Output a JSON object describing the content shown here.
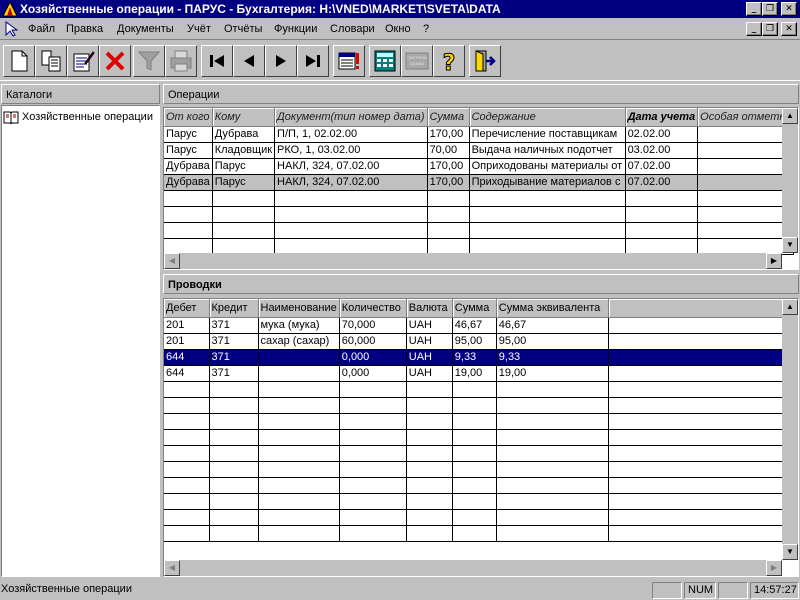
{
  "window": {
    "title": "Хозяйственные операции - ПАРУС - Бухгалтерия: H:\\VNED\\MARKET\\SVETA\\DATA",
    "btn_min": "_",
    "btn_restore": "❐",
    "btn_close": "✕"
  },
  "menu": [
    "Файл",
    "Правка",
    "Документы",
    "Учёт",
    "Отчёты",
    "Функции",
    "Словари",
    "Окно",
    "?"
  ],
  "toolbar": [
    {
      "name": "new-document-icon",
      "interactable": true
    },
    {
      "name": "copy-document-icon",
      "interactable": true
    },
    {
      "name": "edit-document-icon",
      "interactable": true
    },
    {
      "name": "delete-icon",
      "interactable": true
    },
    {
      "name": "filter-icon",
      "interactable": false
    },
    {
      "name": "print-icon",
      "interactable": false
    },
    {
      "name": "first-record-icon",
      "interactable": true
    },
    {
      "name": "previous-record-icon",
      "interactable": true
    },
    {
      "name": "next-record-icon",
      "interactable": true
    },
    {
      "name": "last-record-icon",
      "interactable": true
    },
    {
      "name": "document-journal-icon",
      "interactable": true
    },
    {
      "name": "calculator-icon",
      "interactable": true
    },
    {
      "name": "system-icon",
      "interactable": false,
      "caption1": "система",
      "caption2": "ордер"
    },
    {
      "name": "help-icon",
      "interactable": true
    },
    {
      "name": "exit-icon",
      "interactable": true
    }
  ],
  "catalogs": {
    "header": "Каталоги",
    "items": [
      "Хозяйственные операции"
    ]
  },
  "operations": {
    "header": "Операции",
    "columns": [
      "От кого",
      "Кому",
      "Документ(тип номер дата)",
      "Сумма",
      "Содержание",
      "Дата учета",
      "Особая отметка"
    ],
    "rows": [
      [
        "Парус",
        "Дубрава",
        "П/П, 1, 02.02.00",
        "170,00",
        "Перечисление поставщикам",
        "02.02.00",
        ""
      ],
      [
        "Парус",
        "Кладовщик",
        "РКО, 1, 03.02.00",
        "70,00",
        "Выдача наличных подотчет",
        "03.02.00",
        ""
      ],
      [
        "Дубрава",
        "Парус",
        "НАКЛ, 324, 07.02.00",
        "170,00",
        "Оприходованы материалы от",
        "07.02.00",
        ""
      ],
      [
        "Дубрава",
        "Парус",
        "НАКЛ, 324, 07.02.00",
        "170,00",
        "Приходывание материалов с",
        "07.02.00",
        ""
      ]
    ],
    "selected_row": 3
  },
  "entries": {
    "header": "Проводки",
    "columns": [
      "Дебет",
      "Кредит",
      "Наименование",
      "Количество",
      "Валюта",
      "Сумма",
      "Сумма эквивалента"
    ],
    "rows": [
      [
        "201",
        "371",
        "мука (мука)",
        "70,000",
        "UAH",
        "46,67",
        "46,67"
      ],
      [
        "201",
        "371",
        "сахар (сахар)",
        "60,000",
        "UAH",
        "95,00",
        "95,00"
      ],
      [
        "644",
        "371",
        "",
        "0,000",
        "UAH",
        "9,33",
        "9,33"
      ],
      [
        "644",
        "371",
        "",
        "0,000",
        "UAH",
        "19,00",
        "19,00"
      ]
    ],
    "selected_row": 2
  },
  "status": {
    "text": "Хозяйственные операции",
    "num": "NUM",
    "time": "14:57:27"
  },
  "colors": {
    "titlebar": "#000080",
    "face": "#c0c0c0",
    "selection": "#000080"
  }
}
